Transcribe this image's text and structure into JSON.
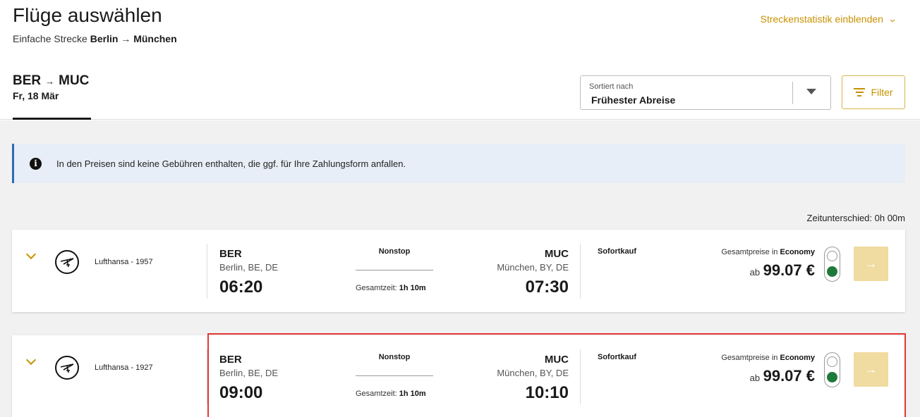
{
  "header": {
    "title": "Flüge auswählen",
    "subtitle_prefix": "Einfache Strecke",
    "origin": "Berlin",
    "destination": "München",
    "route_stats_label": "Streckenstatistik einblenden"
  },
  "tab": {
    "from": "BER",
    "to": "MUC",
    "date": "Fr, 18 Mär"
  },
  "sort": {
    "label": "Sortiert nach",
    "value": "Frühester Abreise"
  },
  "filter": {
    "label": "Filter"
  },
  "info_banner": {
    "icon": "info-icon",
    "text": "In den Preisen sind keine Gebühren enthalten, die ggf. für Ihre Zahlungsform anfallen."
  },
  "time_difference": "Zeitunterschied: 0h 00m",
  "flights": [
    {
      "airline": "Lufthansa - 1957",
      "dep_code": "BER",
      "dep_city": "Berlin, BE, DE",
      "dep_time": "06:20",
      "stops": "Nonstop",
      "duration_label": "Gesamtzeit:",
      "duration": "1h 10m",
      "arr_code": "MUC",
      "arr_city": "München, BY, DE",
      "arr_time": "07:30",
      "booking": "Sofortkauf",
      "price_label": "Gesamtpreise in",
      "cabin": "Economy",
      "price_prefix": "ab",
      "price": "99.07 €"
    },
    {
      "airline": "Lufthansa - 1927",
      "dep_code": "BER",
      "dep_city": "Berlin, BE, DE",
      "dep_time": "09:00",
      "stops": "Nonstop",
      "duration_label": "Gesamtzeit:",
      "duration": "1h 10m",
      "arr_code": "MUC",
      "arr_city": "München, BY, DE",
      "arr_time": "10:10",
      "booking": "Sofortkauf",
      "price_label": "Gesamtpreise in",
      "cabin": "Economy",
      "price_prefix": "ab",
      "price": "99.07 €"
    }
  ],
  "colors": {
    "accent": "#c79100",
    "highlight": "#e53935",
    "info_border": "#2f6bb3",
    "traffic_light_green": "#1f7a3a"
  }
}
